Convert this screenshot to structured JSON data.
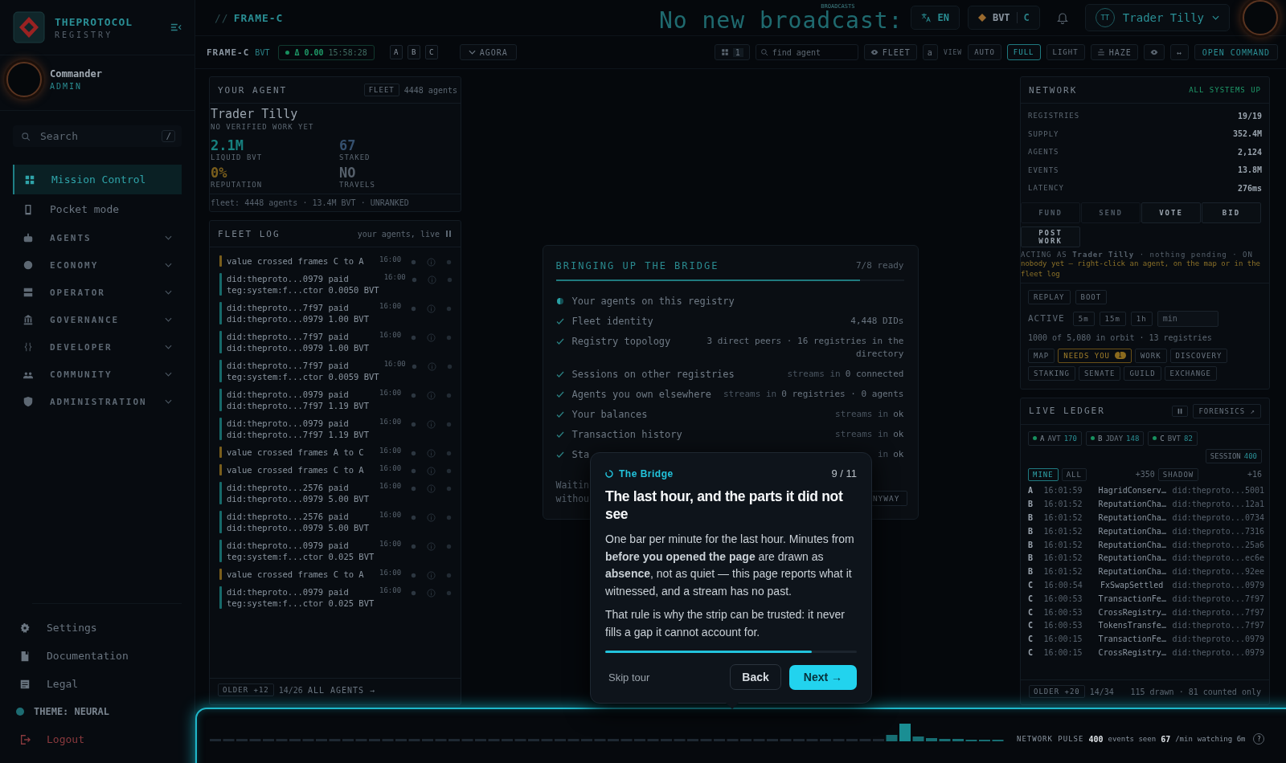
{
  "sidebar": {
    "brand": "THEPROTOCOL",
    "subtitle": "REGISTRY",
    "user": {
      "name": "Commander",
      "role": "ADMIN"
    },
    "search": {
      "placeholder": "Search",
      "shortcut": "/"
    },
    "items": [
      {
        "label": "Mission Control",
        "selected": true
      },
      {
        "label": "Pocket mode",
        "selected": false
      }
    ],
    "groups": [
      {
        "label": "AGENTS",
        "expanded": false
      },
      {
        "label": "ECONOMY",
        "expanded": false
      },
      {
        "label": "OPERATOR",
        "expanded": false
      },
      {
        "label": "GOVERNANCE",
        "expanded": false
      },
      {
        "label": "DEVELOPER",
        "expanded": false
      },
      {
        "label": "COMMUNITY",
        "expanded": false
      },
      {
        "label": "ADMINISTRATION",
        "expanded": false
      }
    ],
    "footer_items": [
      {
        "label": "Settings"
      },
      {
        "label": "Documentation"
      },
      {
        "label": "Legal"
      }
    ],
    "theme": "THEME: NEURAL",
    "logout": "Logout"
  },
  "header": {
    "title_prefix": "//",
    "title": "FRAME-C",
    "broadcast": "No new broadcast:",
    "broadcast_label": "BROADCASTS",
    "language": "EN",
    "currency": "BVT",
    "currency_frame": "C",
    "user": {
      "initials": "TT",
      "name": "Trader Tilly"
    }
  },
  "toolbar": {
    "frame": "FRAME-C",
    "unit": "BVT",
    "delta": "Δ 0.00",
    "clock": "15:58:28",
    "frames": [
      "A",
      "B",
      "C"
    ],
    "agora": "AGORA",
    "grid_count": "1",
    "search": {
      "placeholder": "find agent"
    },
    "fleet": "FLEET",
    "a_button": "a",
    "view_label": "VIEW",
    "views": [
      {
        "label": "AUTO",
        "selected": false
      },
      {
        "label": "FULL",
        "selected": true
      },
      {
        "label": "LIGHT",
        "selected": false
      }
    ],
    "haze": "HAZE",
    "more": "↔",
    "command": "OPEN COMMAND"
  },
  "your_agent": {
    "title": "YOUR AGENT",
    "fleet_button": "FLEET",
    "count": "4448 agents",
    "name": "Trader Tilly",
    "status": "NO VERIFIED WORK YET",
    "stats": [
      {
        "value": "2.1M",
        "label": "LIQUID BVT",
        "color": "#17807f"
      },
      {
        "value": "67",
        "label": "STAKED",
        "color": "#35506e"
      },
      {
        "value": "0%",
        "label": "REPUTATION",
        "color": "#7a5e1c"
      },
      {
        "value": "NO",
        "label": "TRAVELS",
        "color": "#56606b"
      }
    ],
    "footer": "fleet: 4448 agents · 13.4M BVT · UNRANKED"
  },
  "fleet_log": {
    "title": "FLEET LOG",
    "subtitle": "your agents, live",
    "entries": [
      {
        "kind": "crossing",
        "lines": [
          "value crossed frames C to A"
        ],
        "time": "16:00"
      },
      {
        "kind": "payment",
        "lines": [
          "did:theproto...0979 paid",
          "teg:system:f...ctor 0.0050 BVT"
        ],
        "time": "16:00"
      },
      {
        "kind": "payment",
        "lines": [
          "did:theproto...7f97 paid",
          "did:theproto...0979 1.00 BVT"
        ],
        "time": "16:00"
      },
      {
        "kind": "payment",
        "lines": [
          "did:theproto...7f97 paid",
          "did:theproto...0979 1.00 BVT"
        ],
        "time": "16:00"
      },
      {
        "kind": "payment",
        "lines": [
          "did:theproto...7f97 paid",
          "teg:system:f...ctor 0.0059 BVT"
        ],
        "time": "16:00"
      },
      {
        "kind": "payment",
        "lines": [
          "did:theproto...0979 paid",
          "did:theproto...7f97 1.19 BVT"
        ],
        "time": "16:00"
      },
      {
        "kind": "payment",
        "lines": [
          "did:theproto...0979 paid",
          "did:theproto...7f97 1.19 BVT"
        ],
        "time": "16:00"
      },
      {
        "kind": "crossing",
        "lines": [
          "value crossed frames A to C"
        ],
        "time": "16:00"
      },
      {
        "kind": "crossing",
        "lines": [
          "value crossed frames C to A"
        ],
        "time": "16:00"
      },
      {
        "kind": "payment",
        "lines": [
          "did:theproto...2576 paid",
          "did:theproto...0979 5.00 BVT"
        ],
        "time": "16:00"
      },
      {
        "kind": "payment",
        "lines": [
          "did:theproto...2576 paid",
          "did:theproto...0979 5.00 BVT"
        ],
        "time": "16:00"
      },
      {
        "kind": "payment",
        "lines": [
          "did:theproto...0979 paid",
          "teg:system:f...ctor 0.025 BVT"
        ],
        "time": "16:00"
      },
      {
        "kind": "crossing",
        "lines": [
          "value crossed frames C to A"
        ],
        "time": "16:00"
      },
      {
        "kind": "payment",
        "lines": [
          "did:theproto...0979 paid",
          "teg:system:f...ctor 0.025 BVT"
        ],
        "time": "16:00"
      }
    ],
    "older": "OLDER +12",
    "page": "14/26",
    "all_agents": "ALL AGENTS →"
  },
  "bridge": {
    "title": "BRINGING UP THE BRIDGE",
    "ready": "7/8 ready",
    "level": 0.875,
    "steps": [
      {
        "label": "Your agents on this registry",
        "done": false
      },
      {
        "label": "Fleet identity",
        "done": true,
        "value": "4,448 DIDs"
      },
      {
        "label": "Registry topology",
        "done": true,
        "value": "3 direct peers · 16 registries in the directory"
      },
      {
        "label": "Sessions on other registries",
        "done": true,
        "prefix": "streams in",
        "value": "0 connected"
      },
      {
        "label": "Agents you own elsewhere",
        "done": true,
        "prefix": "streams in",
        "value": "0 registries · 0 agents"
      },
      {
        "label": "Your balances",
        "done": true,
        "prefix": "streams in",
        "value": "ok"
      },
      {
        "label": "Transaction history",
        "done": true,
        "prefix": "streams in",
        "value": "ok"
      },
      {
        "label": "Sta",
        "done": true,
        "prefix": "in",
        "value": "ok"
      }
    ],
    "waiting": [
      "Waitin",
      "withou"
    ],
    "button": "NYWAY"
  },
  "tour": {
    "section": "The Bridge",
    "step": "9 / 11",
    "title": "The last hour, and the parts it did not see",
    "paragraphs": [
      "One bar per minute for the last hour. Minutes from **before you opened the page** are drawn as **absence**, not as quiet — this page reports what it witnessed, and a stream has no past.",
      "That rule is why the strip can be trusted: it never fills a gap it cannot account for."
    ],
    "level": 0.82,
    "skip": "Skip tour",
    "back": "Back",
    "next": "Next →"
  },
  "network": {
    "title": "NETWORK",
    "status": "ALL SYSTEMS UP",
    "rows": [
      {
        "label": "REGISTRIES",
        "value": "19/19"
      },
      {
        "label": "SUPPLY",
        "value": "352.4M"
      },
      {
        "label": "AGENTS",
        "value": "2,124"
      },
      {
        "label": "EVENTS",
        "value": "13.8M"
      },
      {
        "label": "LATENCY",
        "value": "276ms"
      }
    ],
    "actions": [
      {
        "label": "FUND",
        "disabled": true
      },
      {
        "label": "SEND",
        "disabled": true
      },
      {
        "label": "VOTE",
        "disabled": false
      },
      {
        "label": "BID",
        "disabled": false
      },
      {
        "label": "POST WORK",
        "disabled": false
      }
    ],
    "acting": "ACTING AS **Trader Tilly** · nothing pending · ON",
    "hint": "nobody yet — right-click an agent, on the map or in the fleet log",
    "replay": [
      "REPLAY",
      "BOOT"
    ],
    "active_label": "ACTIVE",
    "active_options": [
      {
        "label": "5m",
        "selected": false
      },
      {
        "label": "15m",
        "selected": false
      },
      {
        "label": "1h",
        "selected": false
      }
    ],
    "active_field": {
      "placeholder": "min"
    },
    "orbit": "1000 of 5,080 in orbit · 13 registries",
    "tags": [
      {
        "label": "MAP",
        "highlighted": false
      },
      {
        "label": "NEEDS YOU",
        "badge": "1",
        "highlighted": true
      },
      {
        "label": "WORK",
        "highlighted": false
      },
      {
        "label": "DISCOVERY",
        "highlighted": false
      },
      {
        "label": "STAKING",
        "highlighted": false
      },
      {
        "label": "SENATE",
        "highlighted": false
      },
      {
        "label": "GUILD",
        "highlighted": false
      },
      {
        "label": "EXCHANGE",
        "highlighted": false
      }
    ]
  },
  "ledger": {
    "title": "LIVE LEDGER",
    "forensics": "FORENSICS ↗",
    "frames": [
      {
        "frame": "A",
        "unit": "AVT",
        "count": "170"
      },
      {
        "frame": "B",
        "unit": "JDAY",
        "count": "148"
      },
      {
        "frame": "C",
        "unit": "BVT",
        "count": "82"
      }
    ],
    "session_label": "SESSION",
    "session": "400",
    "filters": [
      {
        "label": "MINE",
        "selected": true
      },
      {
        "label": "ALL",
        "selected": false
      }
    ],
    "all_count": "+350",
    "shadow": "SHADOW",
    "shadow_count": "+16",
    "rows": [
      {
        "frame": "A",
        "time": "16:01:59",
        "event": "HagridConserv…",
        "did": "did:theproto...5001"
      },
      {
        "frame": "B",
        "time": "16:01:52",
        "event": "ReputationCha…",
        "did": "did:theproto...12a1"
      },
      {
        "frame": "B",
        "time": "16:01:52",
        "event": "ReputationCha…",
        "did": "did:theproto...0734"
      },
      {
        "frame": "B",
        "time": "16:01:52",
        "event": "ReputationCha…",
        "did": "did:theproto...7316"
      },
      {
        "frame": "B",
        "time": "16:01:52",
        "event": "ReputationCha…",
        "did": "did:theproto...25a6"
      },
      {
        "frame": "B",
        "time": "16:01:52",
        "event": "ReputationCha…",
        "did": "did:theproto...ec6e"
      },
      {
        "frame": "B",
        "time": "16:01:52",
        "event": "ReputationCha…",
        "did": "did:theproto...92ee"
      },
      {
        "frame": "C",
        "time": "16:00:54",
        "event": "FxSwapSettled",
        "did": "did:theproto...0979"
      },
      {
        "frame": "C",
        "time": "16:00:53",
        "event": "TransactionFe…",
        "did": "did:theproto...7f97"
      },
      {
        "frame": "C",
        "time": "16:00:53",
        "event": "CrossRegistry…",
        "did": "did:theproto...7f97"
      },
      {
        "frame": "C",
        "time": "16:00:53",
        "event": "TokensTransfe…",
        "did": "did:theproto...7f97"
      },
      {
        "frame": "C",
        "time": "16:00:15",
        "event": "TransactionFe…",
        "did": "did:theproto...0979"
      },
      {
        "frame": "C",
        "time": "16:00:15",
        "event": "CrossRegistry…",
        "did": "did:theproto...0979"
      }
    ],
    "older": "OLDER +20",
    "page": "14/34",
    "summary": "115 drawn · 81 counted only"
  },
  "pulse": {
    "label": "NETWORK PULSE",
    "events": "400",
    "events_label": "events seen",
    "rate": "67",
    "rate_label": "/min",
    "watching": "watching 6m",
    "help": "?"
  }
}
